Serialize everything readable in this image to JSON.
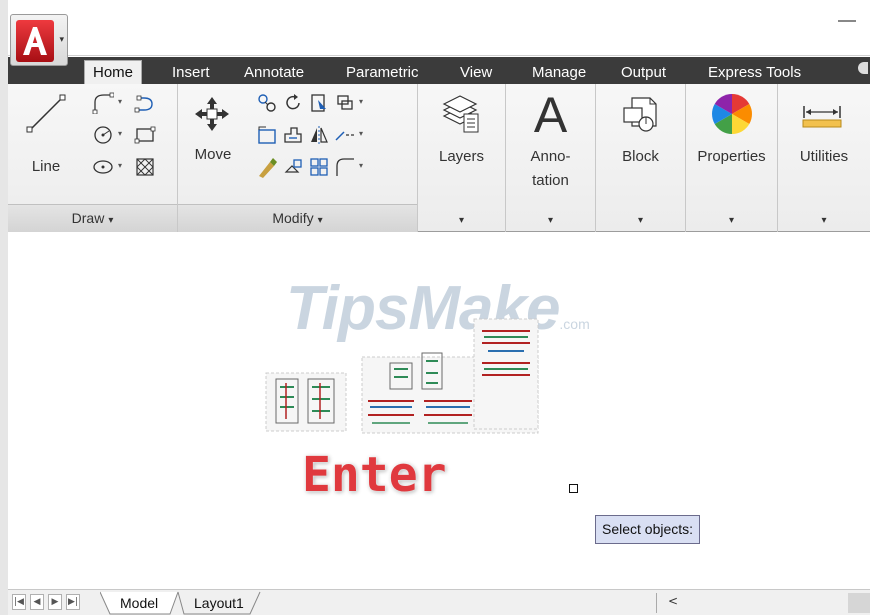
{
  "app": {
    "menu_arrow": "▾"
  },
  "tabs": [
    {
      "label": "Home",
      "active": true
    },
    {
      "label": "Insert"
    },
    {
      "label": "Annotate"
    },
    {
      "label": "Parametric"
    },
    {
      "label": "View"
    },
    {
      "label": "Manage"
    },
    {
      "label": "Output"
    },
    {
      "label": "Express Tools"
    }
  ],
  "ribbon": {
    "draw": {
      "title": "Draw",
      "line_label": "Line"
    },
    "modify": {
      "title": "Modify",
      "move_label": "Move"
    },
    "layers": {
      "label": "Layers"
    },
    "annotation": {
      "label_line1": "Anno-",
      "label_line2": "tation",
      "glyph": "A"
    },
    "block": {
      "label": "Block"
    },
    "properties": {
      "label": "Properties"
    },
    "utilities": {
      "label": "Utilities"
    },
    "group_arrow": "▾"
  },
  "canvas": {
    "watermark": {
      "text": "TipsMake",
      "suffix": ".com"
    },
    "annotation_text": "Enter",
    "command_prompt": "Select objects:"
  },
  "layout_tabs": {
    "nav": [
      "|◀",
      "◀",
      "▶",
      "▶|"
    ],
    "model": "Model",
    "layout1": "Layout1"
  },
  "scroll": {
    "left_arrow": "<"
  },
  "colors": {
    "tab_bar": "#3b3b3b",
    "ribbon_bg": "#f0f0f0",
    "app_red": "#c8161d",
    "prompt_bg": "#d9dff3",
    "enter_red": "#e0393e"
  }
}
